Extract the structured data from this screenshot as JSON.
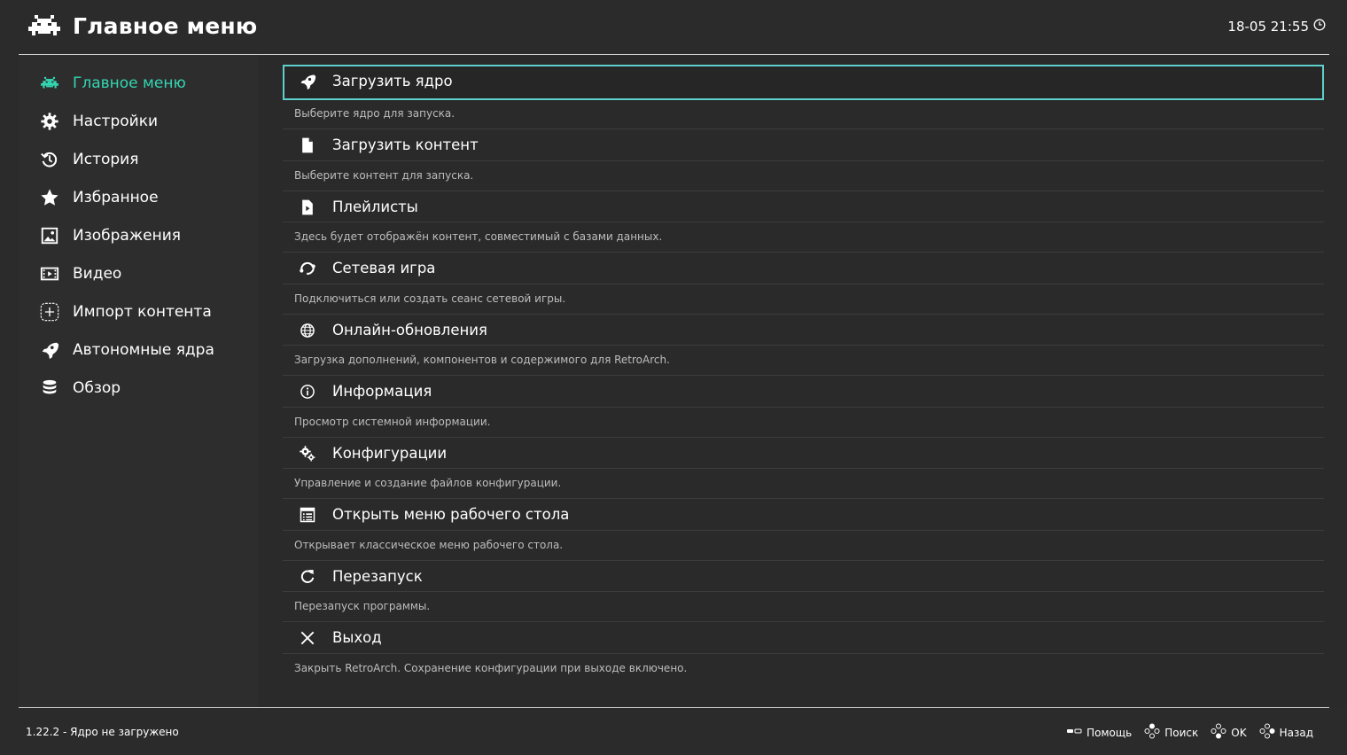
{
  "header": {
    "title": "Главное меню",
    "datetime": "18-05 21:55"
  },
  "colors": {
    "accent": "#34d6b2",
    "selection_border": "#5ed0cc",
    "background": "#2b2b2b"
  },
  "sidebar": {
    "items": [
      {
        "label": "Главное меню",
        "icon": "retroarch-invader-icon",
        "active": true
      },
      {
        "label": "Настройки",
        "icon": "gear-icon"
      },
      {
        "label": "История",
        "icon": "history-icon"
      },
      {
        "label": "Избранное",
        "icon": "star-icon"
      },
      {
        "label": "Изображения",
        "icon": "image-icon"
      },
      {
        "label": "Видео",
        "icon": "film-icon"
      },
      {
        "label": "Импорт контента",
        "icon": "add-content-icon"
      },
      {
        "label": "Автономные ядра",
        "icon": "rocket-icon"
      },
      {
        "label": "Обзор",
        "icon": "database-icon"
      }
    ]
  },
  "menu": {
    "items": [
      {
        "label": "Загрузить ядро",
        "description": "Выберите ядро для запуска.",
        "icon": "rocket-icon",
        "selected": true
      },
      {
        "label": "Загрузить контент",
        "description": "Выберите контент для запуска.",
        "icon": "file-icon"
      },
      {
        "label": "Плейлисты",
        "description": "Здесь будет отображён контент, совместимый с базами данных.",
        "icon": "playlist-file-icon"
      },
      {
        "label": "Сетевая игра",
        "description": "Подключиться или создать сеанс сетевой игры.",
        "icon": "netplay-icon"
      },
      {
        "label": "Онлайн-обновления",
        "description": "Загрузка дополнений, компонентов и содержимого для RetroArch.",
        "icon": "globe-icon"
      },
      {
        "label": "Информация",
        "description": "Просмотр системной информации.",
        "icon": "info-icon"
      },
      {
        "label": "Конфигурации",
        "description": "Управление и создание файлов конфигурации.",
        "icon": "gears-icon"
      },
      {
        "label": "Открыть меню рабочего стола",
        "description": "Открывает классическое меню рабочего стола.",
        "icon": "desktop-menu-icon"
      },
      {
        "label": "Перезапуск",
        "description": "Перезапуск программы.",
        "icon": "restart-icon"
      },
      {
        "label": "Выход",
        "description": "Закрыть RetroArch. Сохранение конфигурации при выходе включено.",
        "icon": "close-icon"
      }
    ]
  },
  "footer": {
    "version": "1.22.2 - Ядро не загружено",
    "hints": [
      {
        "label": "Помощь",
        "icon": "select-button-icon"
      },
      {
        "label": "Поиск",
        "icon": "gamepad-buttons-icon"
      },
      {
        "label": "OK",
        "icon": "gamepad-buttons-icon"
      },
      {
        "label": "Назад",
        "icon": "gamepad-buttons-icon"
      }
    ]
  }
}
